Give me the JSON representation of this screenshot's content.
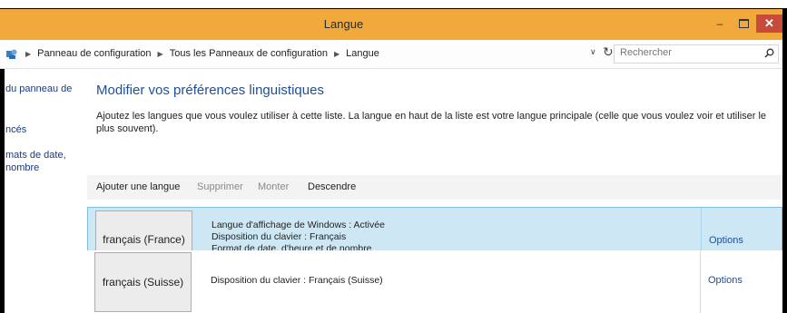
{
  "window": {
    "title": "Langue",
    "minimize_glyph": "–",
    "close_glyph": "✕"
  },
  "address": {
    "icon": "control-panel-icon",
    "crumbs": [
      "Panneau de configuration",
      "Tous les Panneaux de configuration",
      "Langue"
    ],
    "dropdown_glyph": "∨",
    "refresh_glyph": "↻",
    "search_placeholder": "Rechercher"
  },
  "sidebar": {
    "items": [
      "du panneau de",
      "ncés",
      "mats de date,",
      "nombre"
    ]
  },
  "main": {
    "heading": "Modifier vos préférences linguistiques",
    "description": "Ajoutez les langues que vous voulez utiliser à cette liste. La langue en haut de la liste est votre langue principale (celle que vous voulez voir et utiliser le plus souvent).",
    "toolbar": {
      "add": "Ajouter une langue",
      "remove": "Supprimer",
      "up": "Monter",
      "down": "Descendre"
    },
    "languages": [
      {
        "name": "français (France)",
        "details": [
          "Langue d'affichage de Windows : Activée",
          "Disposition du clavier : Français",
          "Format de date, d'heure et de nombre"
        ],
        "options": "Options",
        "selected": true
      },
      {
        "name": "français (Suisse)",
        "details": [
          "Disposition du clavier : Français (Suisse)"
        ],
        "options": "Options",
        "selected": false
      }
    ]
  },
  "colors": {
    "titlebar": "#f2a93b",
    "close_button": "#c74b3b",
    "link": "#1e4e9a",
    "selected_row": "#cde8f4"
  }
}
